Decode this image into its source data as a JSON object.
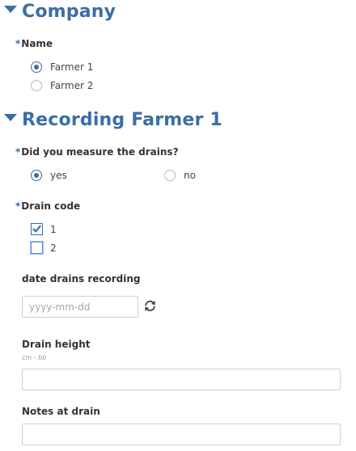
{
  "sections": [
    {
      "title": "Company"
    },
    {
      "title": "Recording Farmer 1"
    }
  ],
  "required_marker": "*",
  "company": {
    "name_label": "Name",
    "options": [
      {
        "label": "Farmer 1",
        "selected": true
      },
      {
        "label": "Farmer 2",
        "selected": false
      }
    ]
  },
  "recording": {
    "measured": {
      "label": "Did you measure the drains?",
      "options": [
        {
          "label": "yes",
          "selected": true
        },
        {
          "label": "no",
          "selected": false
        }
      ]
    },
    "drain_code": {
      "label": "Drain code",
      "options": [
        {
          "label": "1",
          "checked": true
        },
        {
          "label": "2",
          "checked": false
        }
      ]
    },
    "date": {
      "label": "date drains recording",
      "placeholder": "yyyy-mm-dd",
      "value": ""
    },
    "drain_height": {
      "label": "Drain height",
      "hint": "cm - bb",
      "value": ""
    },
    "notes": {
      "label": "Notes at drain",
      "value": ""
    }
  },
  "colors": {
    "accent": "#3b6ea5",
    "text": "#333333",
    "border": "#cfcfcf"
  },
  "icons": {
    "section_toggle": "caret-down-icon",
    "refresh": "refresh-icon",
    "check": "check-icon"
  }
}
